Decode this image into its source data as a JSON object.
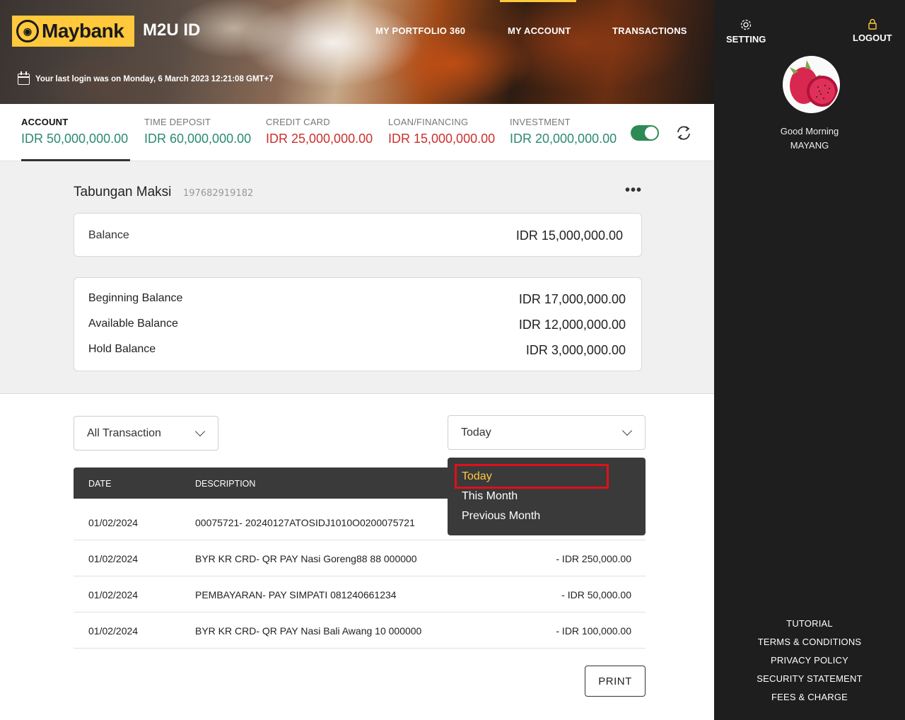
{
  "header": {
    "brand": "Maybank",
    "app_name": "M2U ID",
    "nav": [
      "MY PORTFOLIO 360",
      "MY ACCOUNT",
      "TRANSACTIONS"
    ],
    "last_login": "Your last login was on Monday, 6 March 2023 12:21:08 GMT+7"
  },
  "summary": [
    {
      "label": "ACCOUNT",
      "value": "IDR 50,000,000.00",
      "color": "#2a8a72"
    },
    {
      "label": "TIME DEPOSIT",
      "value": "IDR 60,000,000.00",
      "color": "#2a8a72"
    },
    {
      "label": "CREDIT CARD",
      "value": "IDR 25,000,000.00",
      "color": "#c9302c"
    },
    {
      "label": "LOAN/FINANCING",
      "value": "IDR 15,000,000.00",
      "color": "#c9302c"
    },
    {
      "label": "INVESTMENT",
      "value": "IDR 20,000,000.00",
      "color": "#2a8a72"
    }
  ],
  "account": {
    "name": "Tabungan Maksi",
    "number": "197682919182",
    "balance_label": "Balance",
    "balance_value": "IDR 15,000,000.00",
    "details": [
      {
        "label": "Beginning Balance",
        "value": "IDR 17,000,000.00"
      },
      {
        "label": "Available Balance",
        "value": "IDR 12,000,000.00"
      },
      {
        "label": "Hold Balance",
        "value": "IDR 3,000,000.00"
      }
    ]
  },
  "filters": {
    "type_selected": "All Transaction",
    "period_selected": "Today",
    "period_options": [
      "Today",
      "This Month",
      "Previous Month"
    ]
  },
  "table": {
    "headers": [
      "DATE",
      "DESCRIPTION"
    ],
    "rows": [
      {
        "date": "01/02/2024",
        "description": "00075721- 20240127ATOSIDJ1010O0200075721",
        "amount": ""
      },
      {
        "date": "01/02/2024",
        "description": "BYR KR CRD- QR PAY Nasi Goreng88 88 000000",
        "amount": "- IDR 250,000.00"
      },
      {
        "date": "01/02/2024",
        "description": "PEMBAYARAN- PAY SIMPATI 081240661234",
        "amount": "- IDR 50,000.00"
      },
      {
        "date": "01/02/2024",
        "description": "BYR KR CRD- QR PAY Nasi Bali Awang 10 000000",
        "amount": "- IDR 100,000.00"
      }
    ]
  },
  "print_label": "PRINT",
  "sidebar": {
    "setting": "SETTING",
    "logout": "LOGOUT",
    "greeting": "Good Morning",
    "user": "MAYANG",
    "links": [
      "TUTORIAL",
      "TERMS & CONDITIONS",
      "PRIVACY POLICY",
      "SECURITY STATEMENT",
      "FEES & CHARGE"
    ]
  },
  "colors": {
    "accent_yellow": "#ffc83d",
    "positive": "#2a8a72",
    "negative": "#c9302c",
    "highlight": "#e0101a"
  },
  "icons": [
    "calendar-icon",
    "toggle-switch",
    "refresh-icon",
    "more-icon",
    "chevron-down-icon",
    "gear-icon",
    "lock-icon"
  ]
}
